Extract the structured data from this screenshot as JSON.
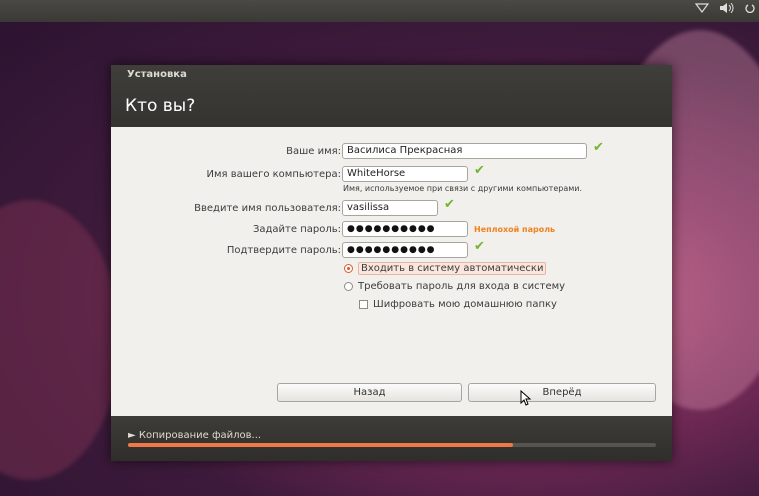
{
  "window": {
    "title": "Установка",
    "page_title": "Кто вы?"
  },
  "form": {
    "name_label": "Ваше имя:",
    "name_value": "Василиса Прекрасная",
    "computer_label": "Имя вашего компьютера:",
    "computer_value": "WhiteHorse",
    "computer_hint": "Имя, используемое при связи с другими компьютерами.",
    "username_label": "Введите имя пользователя:",
    "username_value": "vasilissa",
    "password_label": "Задайте пароль:",
    "password_value": "●●●●●●●●●●",
    "password_strength": "Неплохой пароль",
    "confirm_label": "Подтвердите пароль:",
    "confirm_value": "●●●●●●●●●●"
  },
  "options": {
    "auto_login": "Входить в систему автоматически",
    "require_password": "Требовать пароль для входа в систему",
    "encrypt_home": "Шифровать мою домашнюю папку",
    "selected": "auto_login"
  },
  "buttons": {
    "back": "Назад",
    "forward": "Вперёд"
  },
  "footer": {
    "copy_label": "► Копирование файлов...",
    "progress": 0.73
  },
  "colors": {
    "accent": "#e05a26",
    "progress": "#f07746",
    "check": "#73b52e",
    "strength": "#f0821e"
  },
  "icons": {
    "panel": [
      "network-icon",
      "volume-icon",
      "power-icon"
    ],
    "valid": "checkmark-icon"
  }
}
